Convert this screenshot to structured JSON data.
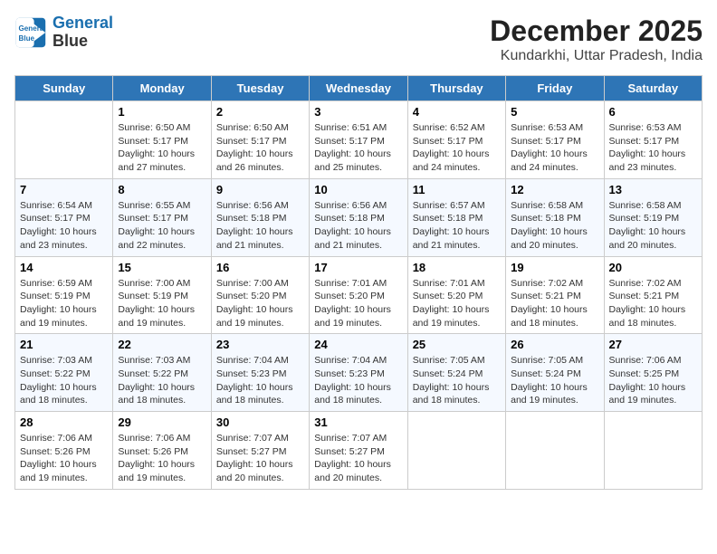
{
  "app": {
    "logo_line1": "General",
    "logo_line2": "Blue"
  },
  "header": {
    "month_year": "December 2025",
    "location": "Kundarkhi, Uttar Pradesh, India"
  },
  "columns": [
    "Sunday",
    "Monday",
    "Tuesday",
    "Wednesday",
    "Thursday",
    "Friday",
    "Saturday"
  ],
  "weeks": [
    [
      {
        "day": "",
        "info": ""
      },
      {
        "day": "1",
        "info": "Sunrise: 6:50 AM\nSunset: 5:17 PM\nDaylight: 10 hours\nand 27 minutes."
      },
      {
        "day": "2",
        "info": "Sunrise: 6:50 AM\nSunset: 5:17 PM\nDaylight: 10 hours\nand 26 minutes."
      },
      {
        "day": "3",
        "info": "Sunrise: 6:51 AM\nSunset: 5:17 PM\nDaylight: 10 hours\nand 25 minutes."
      },
      {
        "day": "4",
        "info": "Sunrise: 6:52 AM\nSunset: 5:17 PM\nDaylight: 10 hours\nand 24 minutes."
      },
      {
        "day": "5",
        "info": "Sunrise: 6:53 AM\nSunset: 5:17 PM\nDaylight: 10 hours\nand 24 minutes."
      },
      {
        "day": "6",
        "info": "Sunrise: 6:53 AM\nSunset: 5:17 PM\nDaylight: 10 hours\nand 23 minutes."
      }
    ],
    [
      {
        "day": "7",
        "info": "Sunrise: 6:54 AM\nSunset: 5:17 PM\nDaylight: 10 hours\nand 23 minutes."
      },
      {
        "day": "8",
        "info": "Sunrise: 6:55 AM\nSunset: 5:17 PM\nDaylight: 10 hours\nand 22 minutes."
      },
      {
        "day": "9",
        "info": "Sunrise: 6:56 AM\nSunset: 5:18 PM\nDaylight: 10 hours\nand 21 minutes."
      },
      {
        "day": "10",
        "info": "Sunrise: 6:56 AM\nSunset: 5:18 PM\nDaylight: 10 hours\nand 21 minutes."
      },
      {
        "day": "11",
        "info": "Sunrise: 6:57 AM\nSunset: 5:18 PM\nDaylight: 10 hours\nand 21 minutes."
      },
      {
        "day": "12",
        "info": "Sunrise: 6:58 AM\nSunset: 5:18 PM\nDaylight: 10 hours\nand 20 minutes."
      },
      {
        "day": "13",
        "info": "Sunrise: 6:58 AM\nSunset: 5:19 PM\nDaylight: 10 hours\nand 20 minutes."
      }
    ],
    [
      {
        "day": "14",
        "info": "Sunrise: 6:59 AM\nSunset: 5:19 PM\nDaylight: 10 hours\nand 19 minutes."
      },
      {
        "day": "15",
        "info": "Sunrise: 7:00 AM\nSunset: 5:19 PM\nDaylight: 10 hours\nand 19 minutes."
      },
      {
        "day": "16",
        "info": "Sunrise: 7:00 AM\nSunset: 5:20 PM\nDaylight: 10 hours\nand 19 minutes."
      },
      {
        "day": "17",
        "info": "Sunrise: 7:01 AM\nSunset: 5:20 PM\nDaylight: 10 hours\nand 19 minutes."
      },
      {
        "day": "18",
        "info": "Sunrise: 7:01 AM\nSunset: 5:20 PM\nDaylight: 10 hours\nand 19 minutes."
      },
      {
        "day": "19",
        "info": "Sunrise: 7:02 AM\nSunset: 5:21 PM\nDaylight: 10 hours\nand 18 minutes."
      },
      {
        "day": "20",
        "info": "Sunrise: 7:02 AM\nSunset: 5:21 PM\nDaylight: 10 hours\nand 18 minutes."
      }
    ],
    [
      {
        "day": "21",
        "info": "Sunrise: 7:03 AM\nSunset: 5:22 PM\nDaylight: 10 hours\nand 18 minutes."
      },
      {
        "day": "22",
        "info": "Sunrise: 7:03 AM\nSunset: 5:22 PM\nDaylight: 10 hours\nand 18 minutes."
      },
      {
        "day": "23",
        "info": "Sunrise: 7:04 AM\nSunset: 5:23 PM\nDaylight: 10 hours\nand 18 minutes."
      },
      {
        "day": "24",
        "info": "Sunrise: 7:04 AM\nSunset: 5:23 PM\nDaylight: 10 hours\nand 18 minutes."
      },
      {
        "day": "25",
        "info": "Sunrise: 7:05 AM\nSunset: 5:24 PM\nDaylight: 10 hours\nand 18 minutes."
      },
      {
        "day": "26",
        "info": "Sunrise: 7:05 AM\nSunset: 5:24 PM\nDaylight: 10 hours\nand 19 minutes."
      },
      {
        "day": "27",
        "info": "Sunrise: 7:06 AM\nSunset: 5:25 PM\nDaylight: 10 hours\nand 19 minutes."
      }
    ],
    [
      {
        "day": "28",
        "info": "Sunrise: 7:06 AM\nSunset: 5:26 PM\nDaylight: 10 hours\nand 19 minutes."
      },
      {
        "day": "29",
        "info": "Sunrise: 7:06 AM\nSunset: 5:26 PM\nDaylight: 10 hours\nand 19 minutes."
      },
      {
        "day": "30",
        "info": "Sunrise: 7:07 AM\nSunset: 5:27 PM\nDaylight: 10 hours\nand 20 minutes."
      },
      {
        "day": "31",
        "info": "Sunrise: 7:07 AM\nSunset: 5:27 PM\nDaylight: 10 hours\nand 20 minutes."
      },
      {
        "day": "",
        "info": ""
      },
      {
        "day": "",
        "info": ""
      },
      {
        "day": "",
        "info": ""
      }
    ]
  ]
}
